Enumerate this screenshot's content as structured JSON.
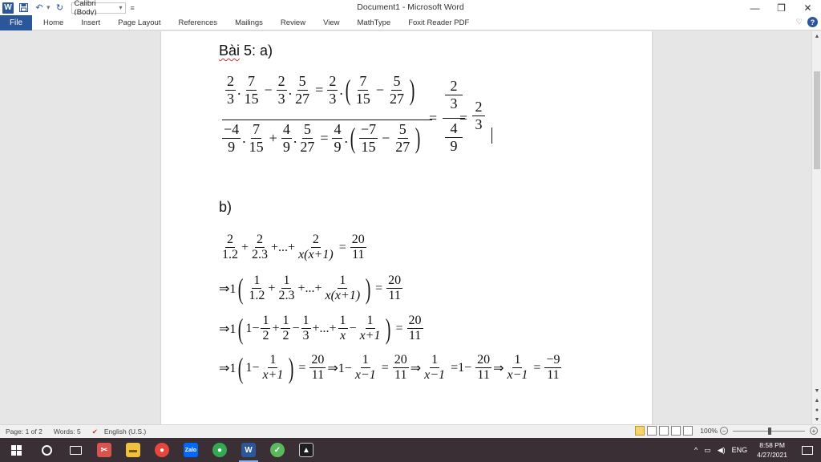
{
  "titlebar": {
    "app_logo": "W",
    "font_name": "Calibri (Body)",
    "document_title": "Document1 - Microsoft Word",
    "window_controls": {
      "minimize": "—",
      "restore": "❐",
      "close": "✕"
    }
  },
  "ribbon": {
    "file_tab": "File",
    "tabs": [
      "Home",
      "Insert",
      "Page Layout",
      "References",
      "Mailings",
      "Review",
      "View",
      "MathType",
      "Foxit Reader PDF"
    ],
    "accent_color": "#2b579a"
  },
  "document": {
    "part_a_heading_word": "Bài",
    "part_a_heading_rest": " 5: a)",
    "part_b_heading": "b)",
    "part_a": {
      "num_row": {
        "f1n": "2",
        "f1d": "3",
        "dot1": ".",
        "f2n": "7",
        "f2d": "15",
        "minus": "−",
        "f3n": "2",
        "f3d": "3",
        "dot2": ".",
        "f4n": "5",
        "f4d": "27",
        "eq": "=",
        "f5n": "2",
        "f5d": "3",
        "dot3": ".",
        "lp": "(",
        "f6n": "7",
        "f6d": "15",
        "minus2": "−",
        "f7n": "5",
        "f7d": "27",
        "rp": ")"
      },
      "den_row": {
        "f1n": "−4",
        "f1d": "9",
        "dot1": ".",
        "f2n": "7",
        "f2d": "15",
        "plus": "+",
        "f3n": "4",
        "f3d": "9",
        "dot2": ".",
        "f4n": "5",
        "f4d": "27",
        "eq": "=",
        "f5n": "4",
        "f5d": "9",
        "dot3": ".",
        "lp": "(",
        "f6n": "−7",
        "f6d": "15",
        "minus2": "−",
        "f7n": "5",
        "f7d": "27",
        "rp": ")"
      },
      "eq1": "=",
      "big_num_n": "2",
      "big_num_d": "3",
      "big_den_n": "4",
      "big_den_d": "9",
      "eq2": "=",
      "result_n": "2",
      "result_d": "3"
    },
    "part_b": {
      "line1": {
        "f1n": "2",
        "f1d": "1.2",
        "plus1": "+",
        "f2n": "2",
        "f2d": "2.3",
        "plus2": "+...+",
        "f3n": "2",
        "f3d": "x(x+1)",
        "eq": "=",
        "rn": "20",
        "rd": "11"
      },
      "line2": {
        "arrow": "⇒1",
        "lp": "(",
        "f1n": "1",
        "f1d": "1.2",
        "plus1": "+",
        "f2n": "1",
        "f2d": "2.3",
        "plus2": "+...+",
        "f3n": "1",
        "f3d": "x(x+1)",
        "rp": ")",
        "eq": "=",
        "rn": "20",
        "rd": "11"
      },
      "line3": {
        "arrow": "⇒1",
        "lp": "(",
        "one": "1−",
        "f1n": "1",
        "f1d": "2",
        "plus1": "+",
        "f2n": "1",
        "f2d": "2",
        "minus1": "−",
        "f3n": "1",
        "f3d": "3",
        "plus2": "+...+",
        "f4n": "1",
        "f4d": "x",
        "minus2": "−",
        "f5n": "1",
        "f5d": "x+1",
        "rp": ")",
        "eq": "=",
        "rn": "20",
        "rd": "11"
      },
      "line4": {
        "arrow": "⇒1",
        "lp": "(",
        "one": "1−",
        "f1n": "1",
        "f1d": "x+1",
        "rp": ")",
        "eq1": "=",
        "f2n": "20",
        "f2d": "11",
        "arrow2": "⇒1−",
        "f3n": "1",
        "f3d": "x−1",
        "eq2": "=",
        "f4n": "20",
        "f4d": "11",
        "arrow3": "⇒",
        "f5n": "1",
        "f5d": "x−1",
        "eq3": "=1−",
        "f6n": "20",
        "f6d": "11",
        "arrow4": "⇒",
        "f7n": "1",
        "f7d": "x−1",
        "eq4": "=",
        "f8n": "−9",
        "f8d": "11"
      }
    }
  },
  "statusbar": {
    "page": "Page: 1 of 2",
    "words": "Words: 5",
    "language": "English (U.S.)",
    "zoom": "100%"
  },
  "taskbar": {
    "apps": [
      "Start",
      "Search",
      "Task View",
      "Snipping Tool",
      "File Explorer",
      "Chrome",
      "Zalo",
      "Chrome Profile",
      "Word",
      "Greenshot",
      "Photos"
    ],
    "tray_language": "ENG",
    "time": "8:58 PM",
    "date": "4/27/2021"
  }
}
